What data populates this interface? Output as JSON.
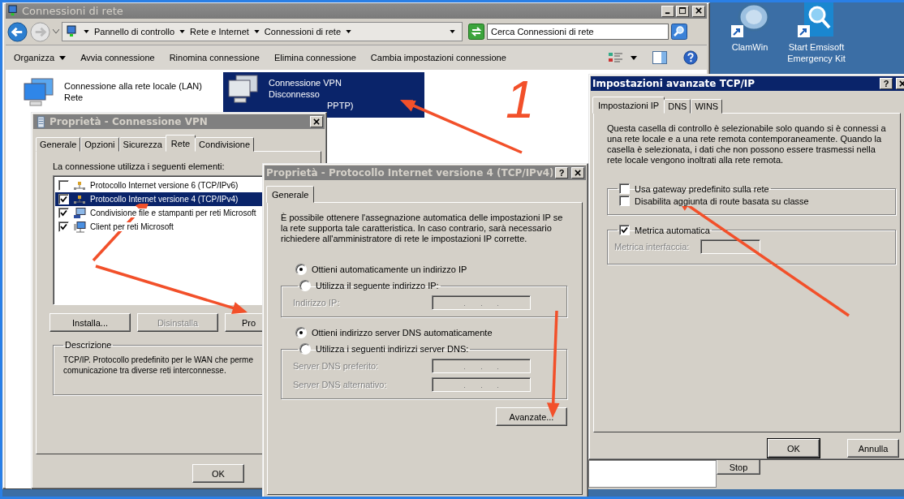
{
  "explorer": {
    "title": "Connessioni di rete",
    "breadcrumb": [
      "Pannello di controllo",
      "Rete e Internet",
      "Connessioni di rete"
    ],
    "search_placeholder": "Cerca Connessioni di rete",
    "toolbar": [
      {
        "label": "Organizza",
        "menu": true
      },
      {
        "label": "Avvia connessione",
        "menu": false
      },
      {
        "label": "Rinomina connessione",
        "menu": false
      },
      {
        "label": "Elimina connessione",
        "menu": false
      },
      {
        "label": "Cambia impostazioni connessione",
        "menu": false
      }
    ],
    "connections": [
      {
        "lines": [
          "Connessione alla rete locale (LAN)",
          "Rete"
        ],
        "selected": false
      },
      {
        "lines": [
          "Connessione VPN",
          "Disconnesso",
          "PPTP)"
        ],
        "selected": true
      }
    ]
  },
  "desktop_icons": [
    {
      "label": "ClamWin",
      "kind": "shield"
    },
    {
      "label": "Start Emsisoft Emergency Kit",
      "kind": "magnifier"
    }
  ],
  "connection_properties": {
    "title": "Proprietà - Connessione VPN",
    "tabs": [
      {
        "label": "Generale",
        "selected": false
      },
      {
        "label": "Opzioni",
        "selected": false
      },
      {
        "label": "Sicurezza",
        "selected": false
      },
      {
        "label": "Rete",
        "selected": true
      },
      {
        "label": "Condivisione",
        "selected": false
      }
    ],
    "list_label": "La connessione utilizza i seguenti elementi:",
    "components": [
      {
        "label": "Protocollo Internet versione 6 (TCP/IPv6)",
        "checked": false,
        "selected": false,
        "kind": "protocol"
      },
      {
        "label": "Protocollo Internet versione 4 (TCP/IPv4)",
        "checked": true,
        "selected": true,
        "kind": "protocol"
      },
      {
        "label": "Condivisione file e stampanti per reti Microsoft",
        "checked": true,
        "selected": false,
        "kind": "service"
      },
      {
        "label": "Client per reti Microsoft",
        "checked": true,
        "selected": false,
        "kind": "client"
      }
    ],
    "buttons": [
      {
        "label": "Installa...",
        "disabled": false
      },
      {
        "label": "Disinstalla",
        "disabled": true
      },
      {
        "label": "Pro",
        "disabled": false
      }
    ],
    "description_title": "Descrizione",
    "description": [
      "TCP/IP. Protocollo predefinito per le WAN che perme",
      "comunicazione tra diverse reti interconnesse."
    ],
    "ok_button": "OK"
  },
  "ipv4_properties": {
    "title": "Proprietà - Protocollo Internet versione 4 (TCP/IPv4)",
    "help_button": "?",
    "tabs": [
      {
        "label": "Generale",
        "selected": true
      }
    ],
    "intro": "È possibile ottenere l'assegnazione automatica delle impostazioni IP se la rete supporta tale caratteristica. In caso contrario, sarà necessario richiedere all'amministratore di rete le impostazioni IP corrette.",
    "ip_options": [
      {
        "label": "Ottieni automaticamente un indirizzo IP",
        "selected": true
      },
      {
        "label": "Utilizza il seguente indirizzo IP:",
        "selected": false
      }
    ],
    "ip_fields": [
      "Indirizzo IP:"
    ],
    "dns_options": [
      {
        "label": "Ottieni indirizzo server DNS automaticamente",
        "selected": true
      },
      {
        "label": "Utilizza i seguenti indirizzi server DNS:",
        "selected": false
      }
    ],
    "dns_fields": [
      "Server DNS preferito:",
      "Server DNS alternativo:"
    ],
    "advanced_button": "Avanzate..."
  },
  "advanced_tcpip": {
    "title": "Impostazioni avanzate TCP/IP",
    "help_button": "?",
    "tabs": [
      {
        "label": "Impostazioni IP",
        "selected": true
      },
      {
        "label": "DNS",
        "selected": false
      },
      {
        "label": "WINS",
        "selected": false
      }
    ],
    "intro": "Questa casella di controllo è selezionabile solo quando si è connessi a una rete locale e a una rete remota contemporaneamente. Quando la casella è selezionata, i dati che non possono essere trasmessi nella rete locale vengono inoltrati alla rete remota.",
    "gateway": {
      "label": "Usa gateway predefinito sulla rete",
      "checked": false
    },
    "class_route": {
      "label": "Disabilita aggiunta di route basata su classe",
      "checked": false
    },
    "auto_metric": {
      "label": "Metrica automatica",
      "checked": true
    },
    "metric_label": "Metrica interfaccia:",
    "buttons": [
      "OK",
      "Annulla"
    ]
  },
  "background_window": {
    "button": "Stop"
  },
  "annotation": {
    "label": "1"
  }
}
